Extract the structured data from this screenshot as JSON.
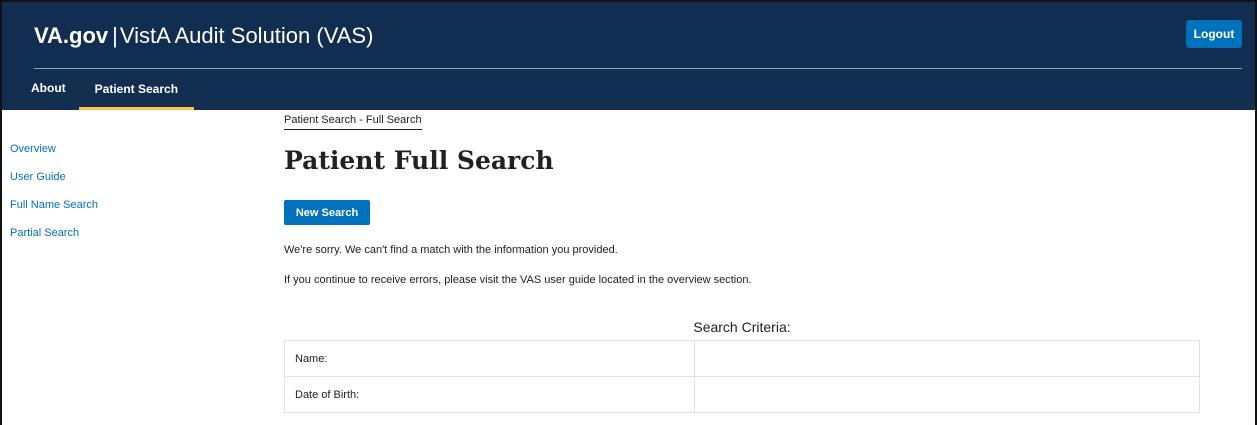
{
  "header": {
    "brand": "VA.gov",
    "separator": "|",
    "app_name": "VistA Audit Solution (VAS)",
    "logout_label": "Logout"
  },
  "nav": {
    "tabs": [
      {
        "label": "About",
        "active": false
      },
      {
        "label": "Patient Search",
        "active": true
      }
    ]
  },
  "sidebar": {
    "items": [
      {
        "label": "Overview"
      },
      {
        "label": "User Guide"
      },
      {
        "label": "Full Name Search"
      },
      {
        "label": "Partial Search"
      }
    ]
  },
  "main": {
    "breadcrumb": "Patient Search - Full Search",
    "title": "Patient Full Search",
    "new_search_label": "New Search",
    "message_1": "We're sorry. We can't find a match with the information you provided.",
    "message_2": "If you continue to receive errors, please visit the VAS user guide located in the overview section.",
    "criteria_title": "Search Criteria:",
    "criteria_rows": [
      {
        "label": "Name:",
        "value": ""
      },
      {
        "label": "Date of Birth:",
        "value": ""
      }
    ]
  },
  "colors": {
    "header_bg": "#112e51",
    "accent_blue": "#0071bb",
    "active_tab_underline": "#f9c642"
  }
}
